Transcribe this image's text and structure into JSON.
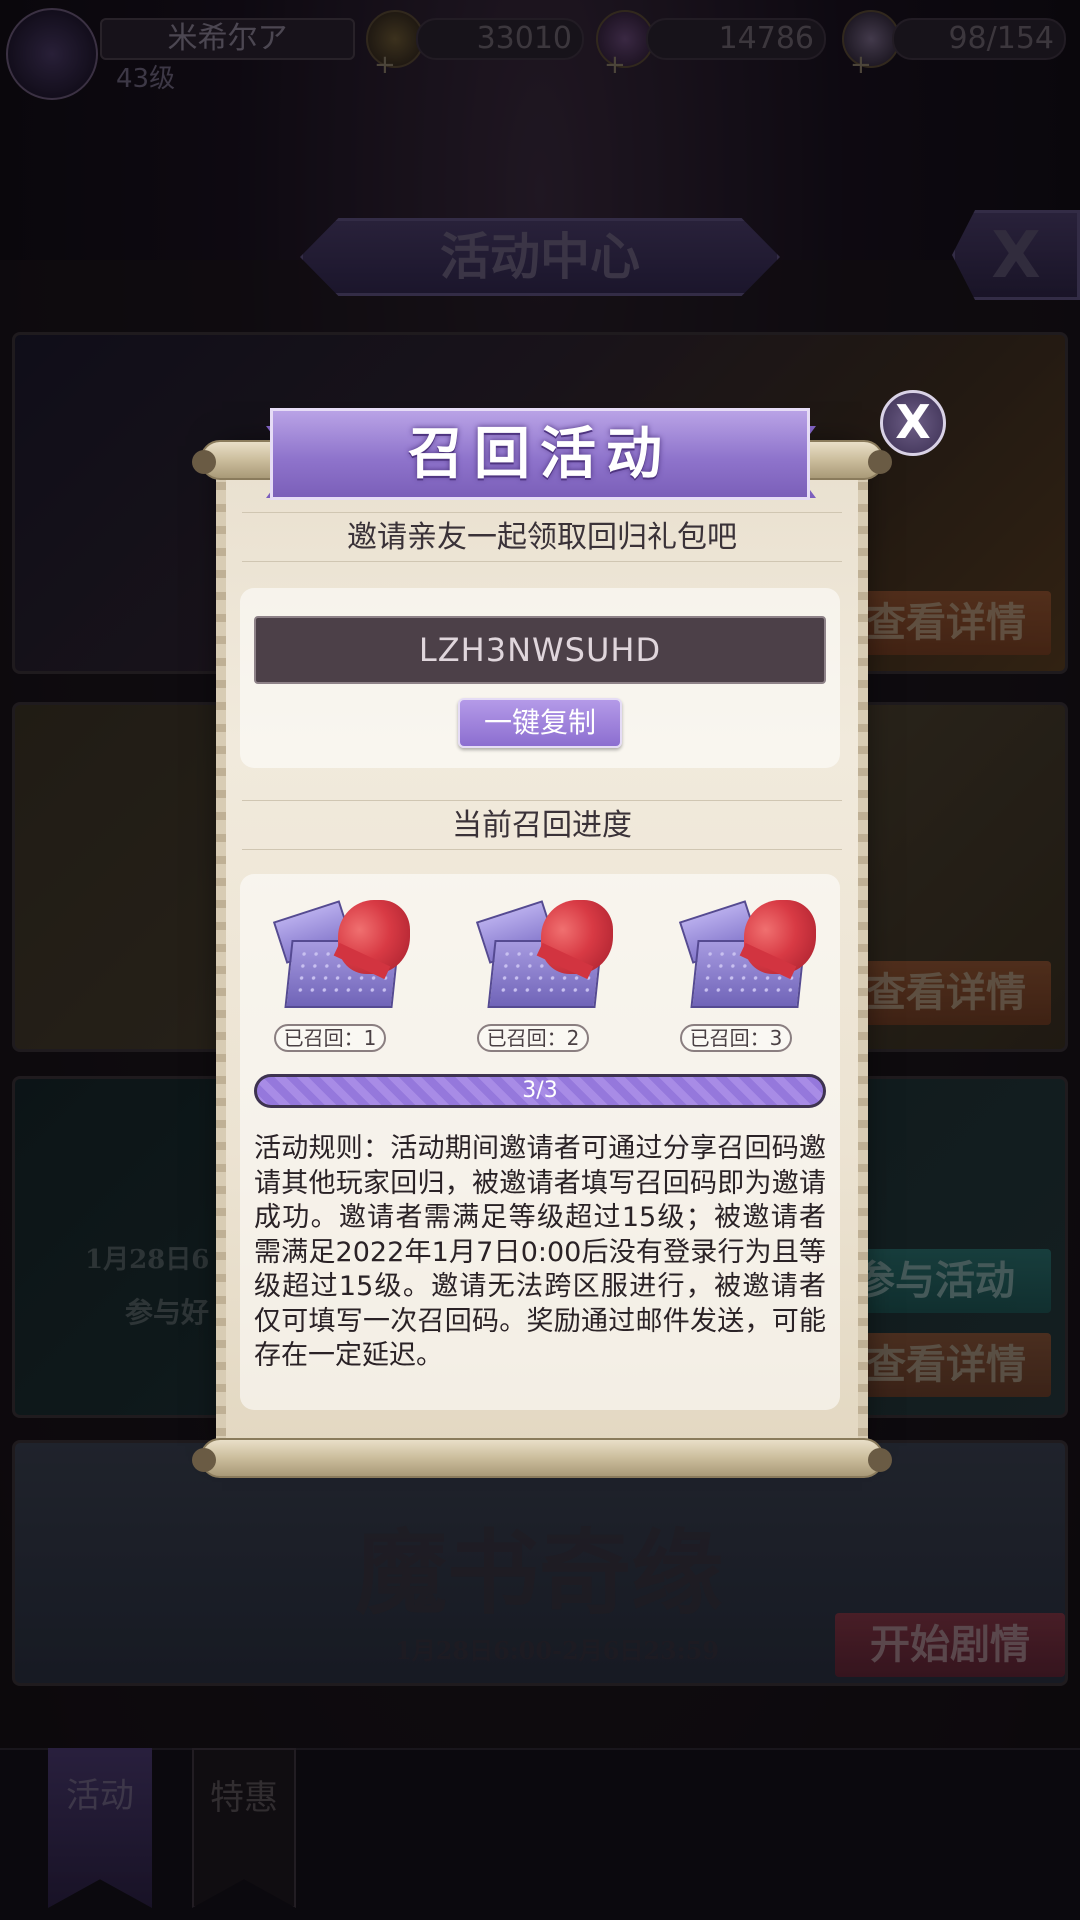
{
  "topbar": {
    "player_name": "米希尔ア",
    "player_level": "43级",
    "gold": "33010",
    "gems": "14786",
    "stamina": "98/154",
    "plus_symbol": "+"
  },
  "background": {
    "title": "活动中心",
    "close_symbol": "X",
    "card_buttons": {
      "detail_1": "查看详情",
      "detail_2": "查看详情",
      "join": "参与活动",
      "detail_3": "查看详情",
      "start_story": "开始剧情"
    },
    "card3_date": "1月28日6",
    "card3_tag": "参与好",
    "card4_title": "魔书奇缘",
    "card4_date": "1月28日6:00-2月6日23:59"
  },
  "bottom_tabs": {
    "activity": "活动",
    "special": "特惠"
  },
  "modal": {
    "title": "召回活动",
    "close_symbol": "X",
    "subtitle": "邀请亲友一起领取回归礼包吧",
    "invite_code": "LZH3NWSUHD",
    "copy_button": "一键复制",
    "progress_heading": "当前召回进度",
    "rewards": [
      {
        "label": "已召回：1",
        "icon": "gift-box-icon"
      },
      {
        "label": "已召回：2",
        "icon": "gift-box-icon"
      },
      {
        "label": "已召回：3",
        "icon": "gift-box-icon"
      }
    ],
    "progress": {
      "current": 3,
      "total": 3,
      "text": "3/3",
      "fraction": 1.0
    },
    "rules": "活动规则：活动期间邀请者可通过分享召回码邀请其他玩家回归，被邀请者填写召回码即为邀请成功。邀请者需满足等级超过15级；被邀请者需满足2022年1月7日0:00后没有登录行为且等级超过15级。邀请无法跨区服进行，被邀请者仅可填写一次召回码。奖励通过邮件发送，可能存在一定延迟。"
  },
  "colors": {
    "accent_purple": "#8f74cc",
    "parchment": "#ece3d2",
    "code_field": "#4c4048"
  }
}
